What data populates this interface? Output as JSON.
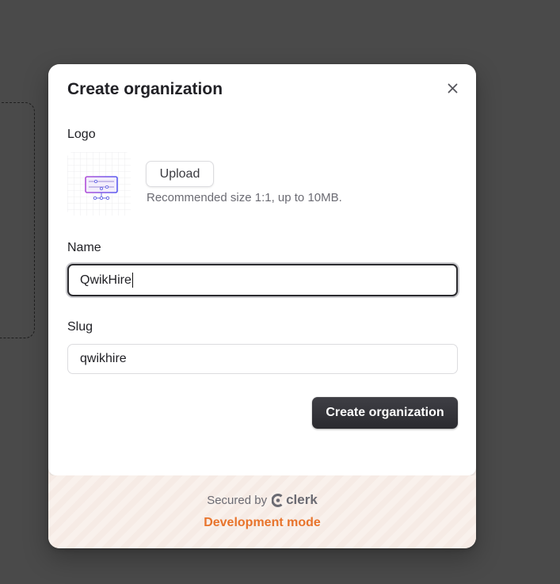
{
  "modal": {
    "title": "Create organization",
    "close_icon": "close-icon"
  },
  "logo": {
    "label": "Logo",
    "upload_label": "Upload",
    "hint": "Recommended size 1:1, up to 10MB."
  },
  "name_field": {
    "label": "Name",
    "value": "QwikHire"
  },
  "slug_field": {
    "label": "Slug",
    "value": "qwikhire"
  },
  "submit_label": "Create organization",
  "footer": {
    "secured_by": "Secured by",
    "brand": "clerk",
    "dev_mode": "Development mode"
  },
  "colors": {
    "primary": "#2f2f34",
    "dev_mode": "#e8742c",
    "backdrop": "#4a4a4a"
  }
}
